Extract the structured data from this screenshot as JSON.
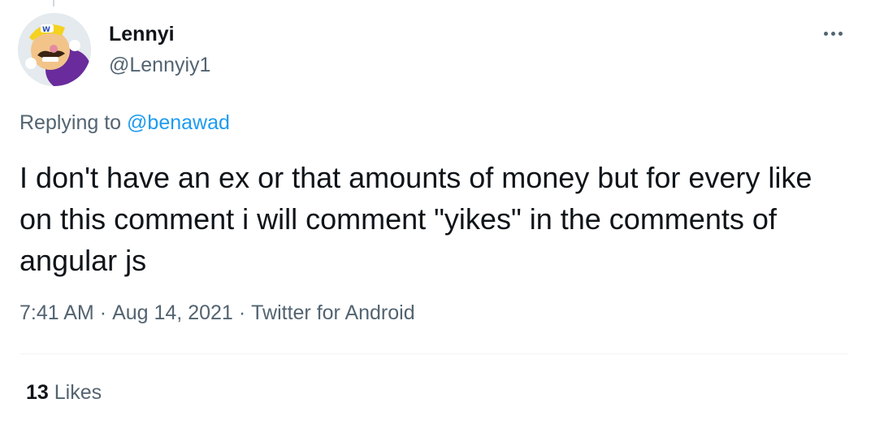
{
  "tweet": {
    "display_name": "Lennyi",
    "handle": "@Lennyiy1",
    "replying_prefix": "Replying to",
    "replying_to": "@benawad",
    "text": "I don't have an ex or that amounts of money but for every like on this comment i will comment \"yikes\" in the comments of angular js",
    "time": "7:41 AM",
    "date": "Aug 14, 2021",
    "source": "Twitter for Android",
    "separator": "·",
    "likes_count": "13",
    "likes_label": "Likes"
  },
  "icons": {
    "avatar": "wario-avatar",
    "more": "more-horizontal-icon"
  },
  "colors": {
    "text": "#0f1419",
    "secondary": "#536471",
    "link": "#1d9bf0",
    "divider": "#eff3f4"
  }
}
